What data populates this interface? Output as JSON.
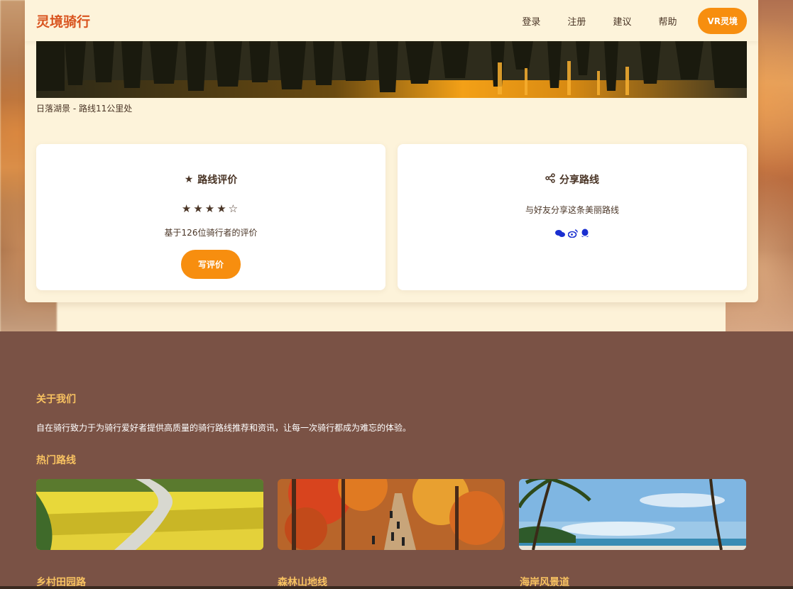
{
  "nav": {
    "brand": "灵境骑行",
    "links": [
      "登录",
      "注册",
      "建议",
      "帮助"
    ],
    "vr_button": "VR灵境"
  },
  "hero": {
    "caption": "日落湖景 - 路线11公里处"
  },
  "rating_card": {
    "title": "路线评价",
    "stars": "★★★★☆",
    "rating_value": 4,
    "rating_max": 5,
    "summary": "基于126位骑行者的评价",
    "button": "写评价"
  },
  "share_card": {
    "title": "分享路线",
    "text": "与好友分享这条美丽路线",
    "icons": [
      "wechat-icon",
      "weibo-icon",
      "qq-icon"
    ]
  },
  "footer": {
    "about_title": "关于我们",
    "about_text": "自在骑行致力于为骑行爱好者提供高质量的骑行路线推荐和资讯，让每一次骑行都成为难忘的体验。",
    "hot_title": "热门路线",
    "routes": [
      {
        "name": "乡村田园路"
      },
      {
        "name": "森林山地线"
      },
      {
        "name": "海岸风景道"
      }
    ]
  },
  "colors": {
    "accent": "#f78e0f",
    "brand": "#d9541f",
    "footer_bg": "#7a5245",
    "footer_heading": "#f8c261",
    "share_icon": "#1a2fd0"
  }
}
